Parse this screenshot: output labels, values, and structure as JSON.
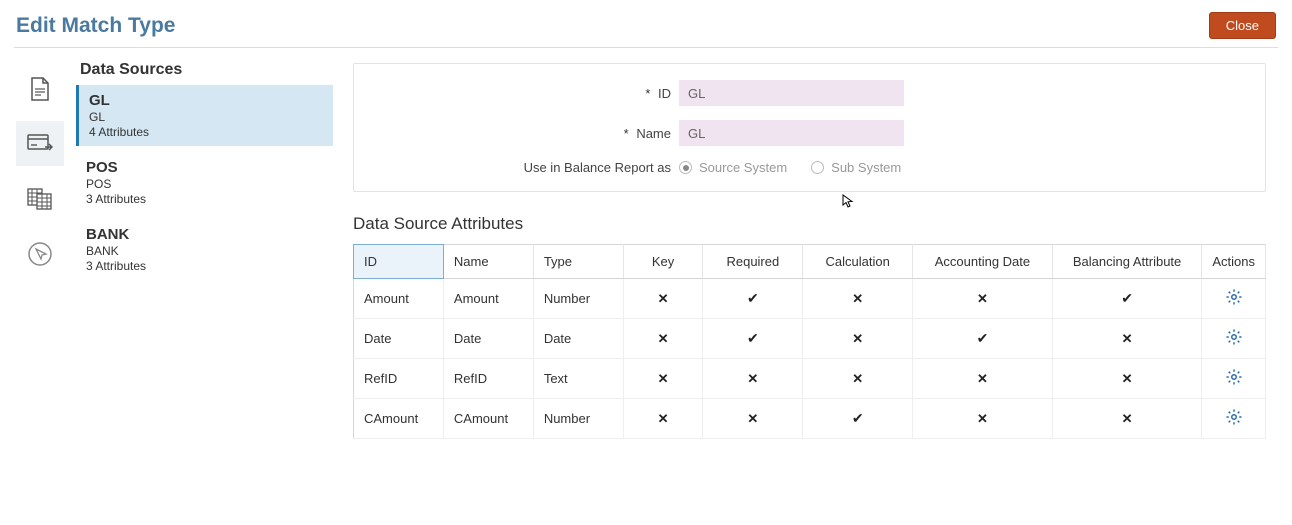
{
  "header": {
    "title": "Edit Match Type",
    "close_label": "Close"
  },
  "sidebar": {
    "heading": "Data Sources",
    "items": [
      {
        "name": "GL",
        "sub": "GL",
        "attrs": "4 Attributes",
        "selected": true
      },
      {
        "name": "POS",
        "sub": "POS",
        "attrs": "3 Attributes",
        "selected": false
      },
      {
        "name": "BANK",
        "sub": "BANK",
        "attrs": "3 Attributes",
        "selected": false
      }
    ]
  },
  "form": {
    "id_label": "ID",
    "id_value": "GL",
    "name_label": "Name",
    "name_value": "GL",
    "balance_label": "Use in Balance Report as",
    "opt_source": "Source System",
    "opt_sub": "Sub System",
    "balance_selected": "source"
  },
  "attributes": {
    "heading": "Data Source Attributes",
    "columns": [
      "ID",
      "Name",
      "Type",
      "Key",
      "Required",
      "Calculation",
      "Accounting Date",
      "Balancing Attribute",
      "Actions"
    ],
    "rows": [
      {
        "id": "Amount",
        "name": "Amount",
        "type": "Number",
        "key": false,
        "required": true,
        "calculation": false,
        "accounting_date": false,
        "balancing": true
      },
      {
        "id": "Date",
        "name": "Date",
        "type": "Date",
        "key": false,
        "required": true,
        "calculation": false,
        "accounting_date": true,
        "balancing": false
      },
      {
        "id": "RefID",
        "name": "RefID",
        "type": "Text",
        "key": false,
        "required": false,
        "calculation": false,
        "accounting_date": false,
        "balancing": false
      },
      {
        "id": "CAmount",
        "name": "CAmount",
        "type": "Number",
        "key": false,
        "required": false,
        "calculation": true,
        "accounting_date": false,
        "balancing": false
      }
    ]
  },
  "icons": {
    "gear": "gear-icon",
    "doc": "document-icon",
    "card": "card-icon",
    "grid": "grid-icon",
    "pointer": "pointer-icon"
  }
}
